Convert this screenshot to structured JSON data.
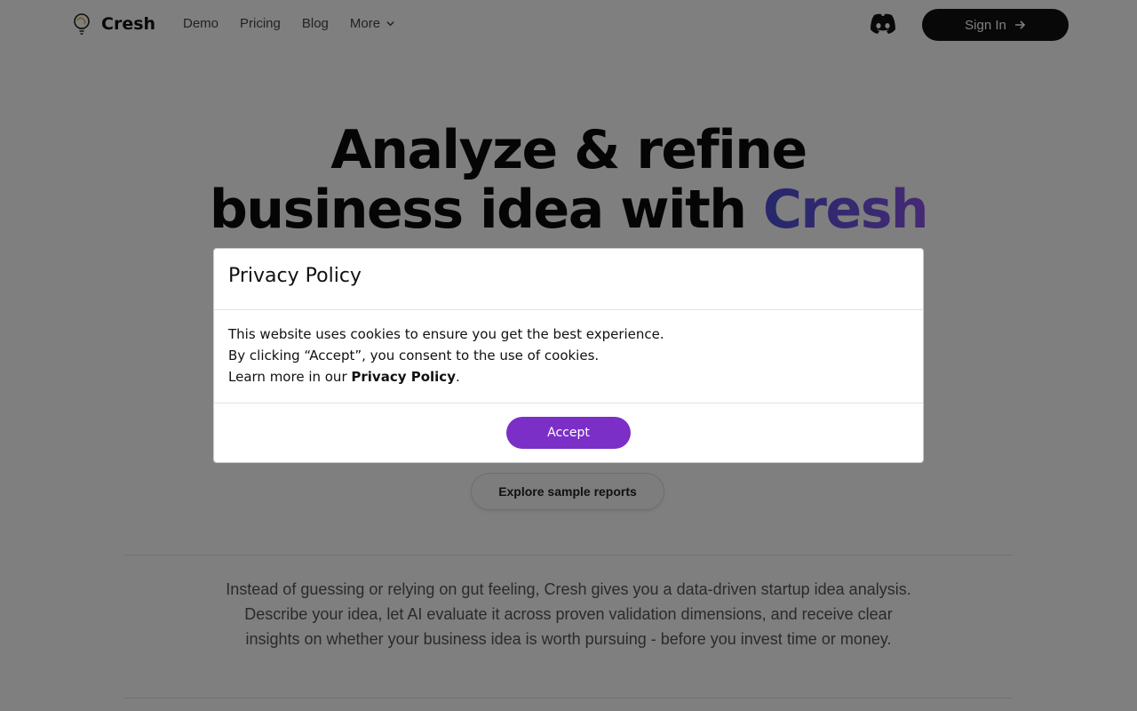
{
  "header": {
    "brand": "Cresh",
    "nav": [
      {
        "label": "Demo"
      },
      {
        "label": "Pricing"
      },
      {
        "label": "Blog"
      },
      {
        "label": "More"
      }
    ],
    "sign_in_label": "Sign In"
  },
  "hero": {
    "title_line1": "Analyze & refine",
    "title_line2_prefix": "business idea with",
    "title_brand": "Cresh",
    "explore_label": "Explore sample reports",
    "description": "Instead of guessing or relying on gut feeling, Cresh gives you a data-driven startup idea analysis. Describe your idea, let AI evaluate it across proven validation dimensions, and receive clear insights on whether your business idea is worth pursuing - before you invest time or money."
  },
  "modal": {
    "title": "Privacy Policy",
    "line1": "This website uses cookies to ensure you get the best experience.",
    "line2": "By clicking “Accept”, you consent to the use of cookies.",
    "line3_prefix": "Learn more in our ",
    "line3_link": "Privacy Policy",
    "line3_suffix": ".",
    "accept_label": "Accept"
  },
  "colors": {
    "accent": "#7b2fc7",
    "brand_gradient_start": "#4b4fd8",
    "brand_gradient_end": "#8a55e8",
    "dark_button": "#111111"
  },
  "icons": {
    "logo": "lightbulb-brain-icon",
    "discord": "discord-icon",
    "more_chevron": "chevron-down-icon",
    "sign_in_arrow": "arrow-right-icon"
  }
}
